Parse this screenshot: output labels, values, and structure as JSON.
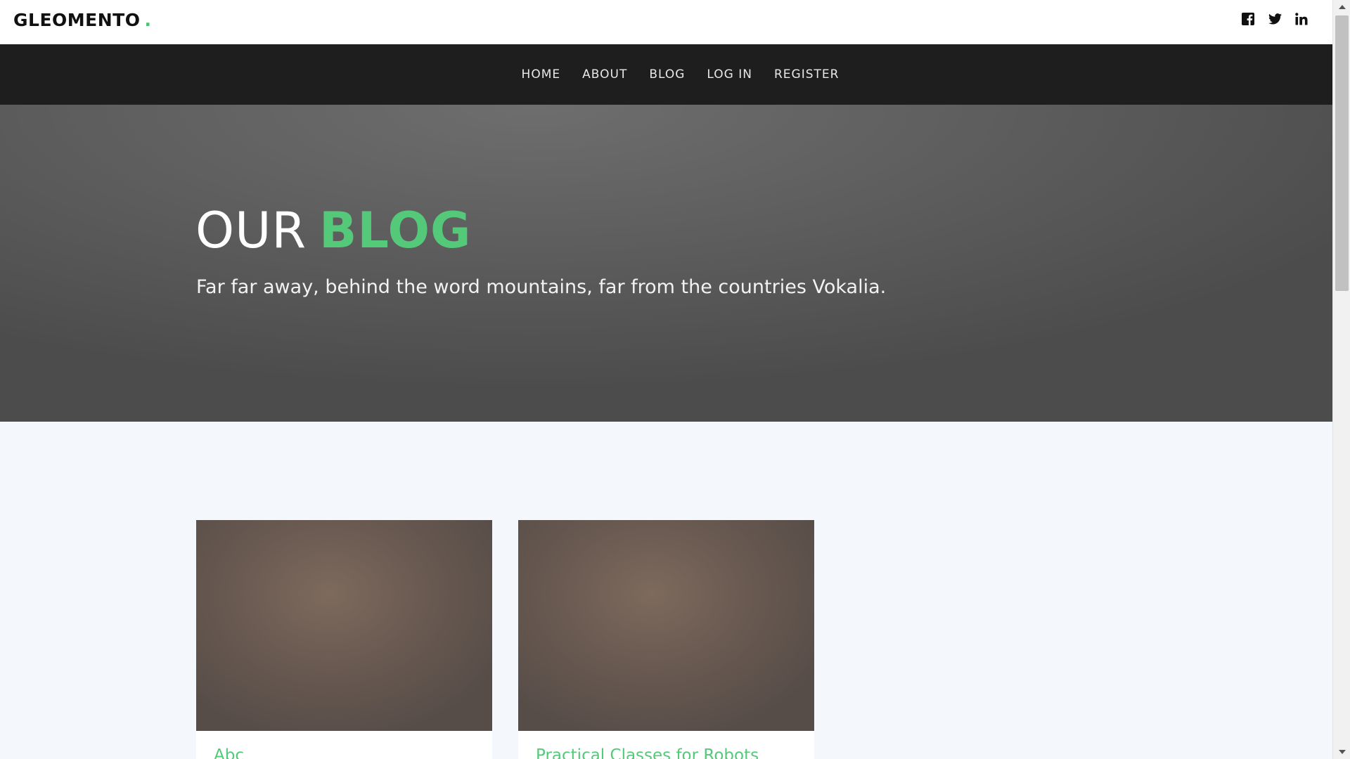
{
  "header": {
    "brand": "GLEOMENTO",
    "brand_dot": ".",
    "socials": [
      "facebook-icon",
      "twitter-icon",
      "linkedin-icon"
    ]
  },
  "nav": {
    "items": [
      {
        "label": "HOME"
      },
      {
        "label": "ABOUT"
      },
      {
        "label": "BLOG"
      },
      {
        "label": "LOG IN"
      },
      {
        "label": "REGISTER"
      }
    ]
  },
  "hero": {
    "title_plain": "OUR",
    "title_accent": "BLOG",
    "subtitle": "Far far away, behind the word mountains, far from the countries Vokalia."
  },
  "posts": [
    {
      "title": "Abc"
    },
    {
      "title": "Practical Classes for Robots"
    }
  ],
  "colors": {
    "accent": "#55c97a",
    "nav_bg": "#1e1e1e",
    "hero_bg": "#5f5f5f",
    "page_bg": "#f4f7fb"
  }
}
